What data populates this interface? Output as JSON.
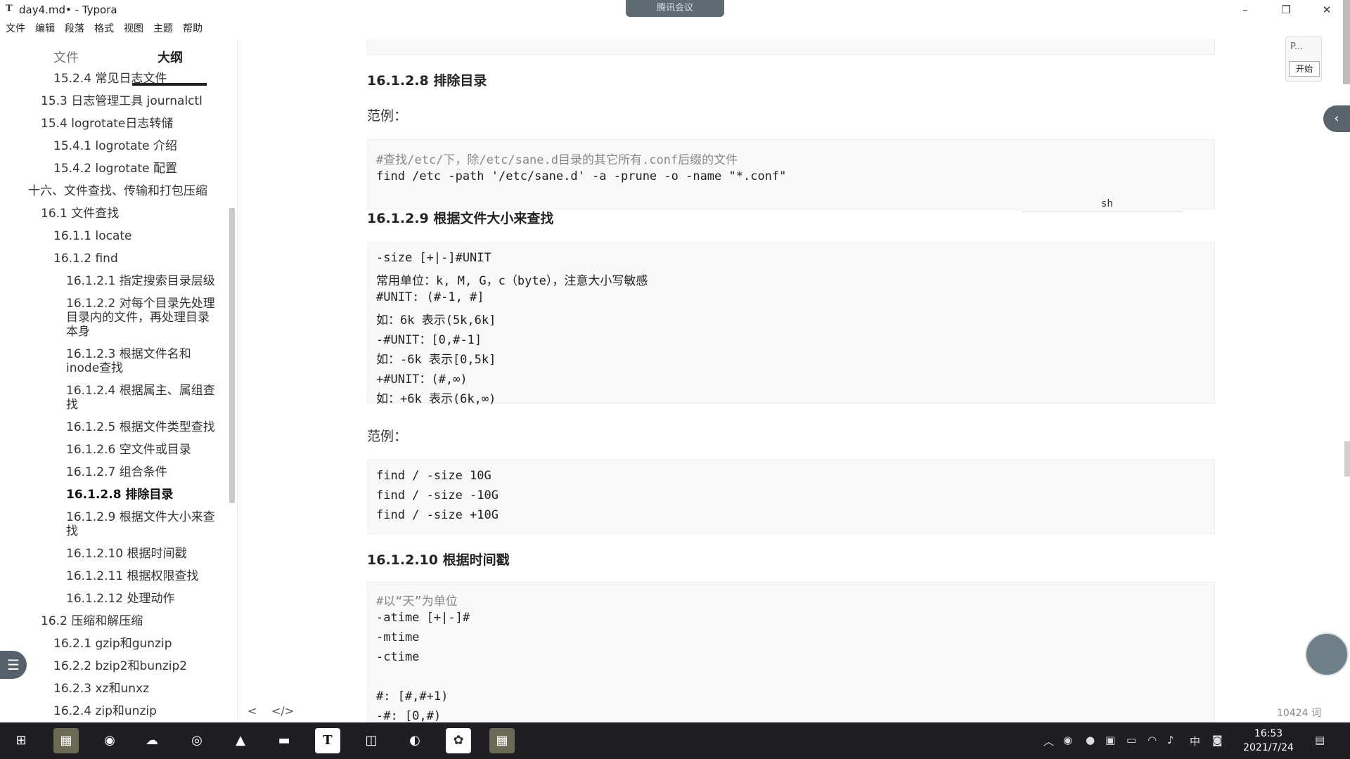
{
  "window": {
    "title": "day4.md• - Typora",
    "app_icon": "T",
    "meeting_label": "腾讯会议",
    "controls": [
      "–",
      "❐",
      "✕"
    ]
  },
  "menu": [
    "文件",
    "编辑",
    "段落",
    "格式",
    "视图",
    "主题",
    "帮助"
  ],
  "sidebar": {
    "tabs": [
      "文件",
      "大纲"
    ],
    "outline": [
      {
        "text": "15.2.4 常见日志文件",
        "level": 3
      },
      {
        "text": "15.3 日志管理工具 journalctl",
        "level": 2
      },
      {
        "text": "15.4 logrotate日志转储",
        "level": 2
      },
      {
        "text": "15.4.1 logrotate 介绍",
        "level": 3
      },
      {
        "text": "15.4.2 logrotate 配置",
        "level": 3
      },
      {
        "text": "十六、文件查找、传输和打包压缩",
        "level": 1
      },
      {
        "text": "16.1 文件查找",
        "level": 2
      },
      {
        "text": "16.1.1 locate",
        "level": 3
      },
      {
        "text": "16.1.2 find",
        "level": 3
      },
      {
        "text": "16.1.2.1 指定搜索目录层级",
        "level": 4
      },
      {
        "text": "16.1.2.2 对每个目录先处理",
        "level": 4
      },
      {
        "text": "目录内的文件，再处理目录",
        "level": 4
      },
      {
        "text": "本身",
        "level": 4
      },
      {
        "text": "16.1.2.3 根据文件名和",
        "level": 4
      },
      {
        "text": "inode查找",
        "level": 4
      },
      {
        "text": "16.1.2.4 根据属主、属组查",
        "level": 4
      },
      {
        "text": "找",
        "level": 4
      },
      {
        "text": "16.1.2.5 根据文件类型查找",
        "level": 4
      },
      {
        "text": "16.1.2.6 空文件或目录",
        "level": 4
      },
      {
        "text": "16.1.2.7 组合条件",
        "level": 4
      },
      {
        "text": "16.1.2.8 排除目录",
        "level": 4,
        "bold": true
      },
      {
        "text": "16.1.2.9 根据文件大小来查",
        "level": 4
      },
      {
        "text": "找",
        "level": 4
      },
      {
        "text": "16.1.2.10 根据时间戳",
        "level": 4
      },
      {
        "text": "16.1.2.11 根据权限查找",
        "level": 4
      },
      {
        "text": "16.1.2.12 处理动作",
        "level": 4
      },
      {
        "text": "16.2 压缩和解压缩",
        "level": 2
      },
      {
        "text": "16.2.1 gzip和gunzip",
        "level": 3
      },
      {
        "text": "16.2.2 bzip2和bunzip2",
        "level": 3
      },
      {
        "text": "16.2.3 xz和unxz",
        "level": 3
      },
      {
        "text": "16.2.4 zip和unzip",
        "level": 3
      }
    ]
  },
  "content": {
    "h_1628": "16.1.2.8 排除目录",
    "example1": "范例：",
    "code1": [
      {
        "text": "#查找/etc/下，除/etc/sane.d目录的其它所有.conf后缀的文件",
        "comment": true
      },
      {
        "text": "find /etc -path '/etc/sane.d' -a -prune -o -name \"*.conf\"",
        "comment": false
      }
    ],
    "code1_lang": "sh",
    "h_1629": "16.1.2.9 根据文件大小来查找",
    "code2": [
      {
        "text": "-size [+|-]#UNIT",
        "comment": false
      },
      {
        "text": "常用单位：k, M, G，c（byte），注意大小写敏感",
        "comment": false
      },
      {
        "text": "#UNIT: (#-1, #]",
        "comment": false
      },
      {
        "text": "如：6k 表示(5k,6k]",
        "comment": false
      },
      {
        "text": "-#UNIT：[0,#-1]",
        "comment": false
      },
      {
        "text": "如：-6k 表示[0,5k]",
        "comment": false
      },
      {
        "text": "+#UNIT：(#,∞)",
        "comment": false
      },
      {
        "text": "如：+6k 表示(6k,∞)",
        "comment": false
      }
    ],
    "example2": "范例：",
    "code3": [
      {
        "text": "find / -size 10G",
        "comment": false
      },
      {
        "text": "find / -size -10G",
        "comment": false
      },
      {
        "text": "find / -size +10G",
        "comment": false
      }
    ],
    "h_16210": "16.1.2.10 根据时间戳",
    "code4": [
      {
        "text": "#以“天”为单位",
        "comment": true
      },
      {
        "text": "-atime [+|-]#",
        "comment": false
      },
      {
        "text": "-mtime",
        "comment": false
      },
      {
        "text": "-ctime",
        "comment": false
      },
      {
        "text": "",
        "comment": false
      },
      {
        "text": "#: [#,#+1)",
        "comment": false
      },
      {
        "text": "-#: [0,#)",
        "comment": false
      }
    ]
  },
  "floating": {
    "pill_text": "P...",
    "start_label": "开始"
  },
  "status": {
    "word_count": "10424 词",
    "source_toggle": "</>",
    "collapse": "<"
  },
  "taskbar": {
    "time": "16:53",
    "date": "2021/7/24",
    "ime": "中"
  }
}
